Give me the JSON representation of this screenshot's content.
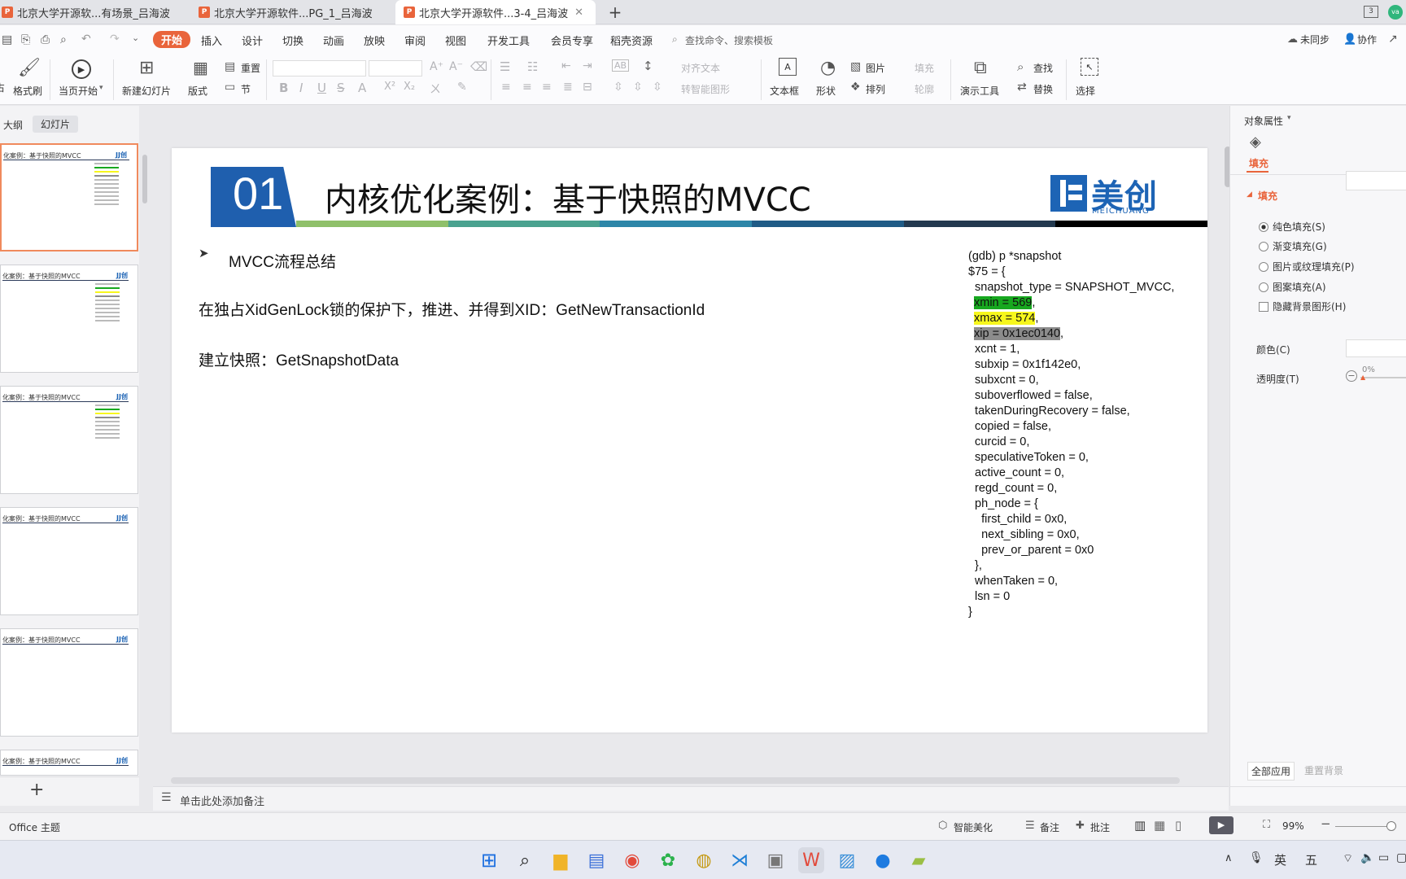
{
  "tabs": [
    {
      "label": "北京大学开源软...有场景_吕海波",
      "active": false
    },
    {
      "label": "北京大学开源软件...PG_1_吕海波",
      "active": false
    },
    {
      "label": "北京大学开源软件...3-4_吕海波",
      "active": true
    }
  ],
  "tabbar": {
    "new_tab": "+",
    "win_badge": "3"
  },
  "menu": {
    "items": [
      "开始",
      "插入",
      "设计",
      "切换",
      "动画",
      "放映",
      "审阅",
      "视图",
      "开发工具",
      "会员专享",
      "稻壳资源"
    ],
    "search_placeholder": "查找命令、搜索模板",
    "sync": "未同步",
    "collab": "协作"
  },
  "ribbon": {
    "format_painter": "格式刷",
    "play_from_current": "当页开始",
    "new_slide": "新建幻灯片",
    "layout": "版式",
    "reset": "重置",
    "section": "节",
    "align_text": "对齐文本",
    "smart_graphic": "转智能图形",
    "textbox": "文本框",
    "shape": "形状",
    "picture": "图片",
    "arrange": "排列",
    "fill": "填充",
    "outline": "轮廓",
    "present_tools": "演示工具",
    "find": "查找",
    "replace": "替换",
    "select": "选择"
  },
  "panel": {
    "outline_tab": "大纲",
    "slides_tab": "幻灯片",
    "thumb_title": "化案例：基于快照的MVCC",
    "thumb_logo": "JJ创",
    "add": "+"
  },
  "slide": {
    "number": "01",
    "title": "内核优化案例：基于快照的MVCC",
    "logo_main": "美创",
    "logo_sub": "MEICHUANG",
    "bullet": "MVCC流程总结",
    "para1": "在独占XidGenLock锁的保护下，推进、并得到XID：GetNewTransactionId",
    "para2": "建立快照：GetSnapshotData",
    "code": {
      "l1": "(gdb) p *snapshot",
      "l2": "$75 = {",
      "l3": "  snapshot_type = SNAPSHOT_MVCC,",
      "l4a": "xmin = 569",
      "l5a": "xmax = 574",
      "l6a": "xip = 0x1ec0140",
      "comma": ",",
      "l7": "  xcnt = 1,",
      "l8": "  subxip = 0x1f142e0,",
      "l9": "  subxcnt = 0,",
      "l10": "  suboverflowed = false,",
      "l11": "  takenDuringRecovery = false,",
      "l12": "  copied = false,",
      "l13": "  curcid = 0,",
      "l14": "  speculativeToken = 0,",
      "l15": "  active_count = 0,",
      "l16": "  regd_count = 0,",
      "l17": "  ph_node = {",
      "l18": "    first_child = 0x0,",
      "l19": "    next_sibling = 0x0,",
      "l20": "    prev_or_parent = 0x0",
      "l21": "  },",
      "l22": "  whenTaken = 0,",
      "l23": "  lsn = 0",
      "l24": "}"
    }
  },
  "rightpanel": {
    "header": "对象属性",
    "fill_tab": "填充",
    "fill_section": "填充",
    "options": [
      "纯色填充(S)",
      "渐变填充(G)",
      "图片或纹理填充(P)",
      "图案填充(A)"
    ],
    "hide_bg": "隐藏背景图形(H)",
    "color": "颜色(C)",
    "transparency": "透明度(T)",
    "transparency_value": "0%",
    "apply_all": "全部应用",
    "reset_bg": "重置背景"
  },
  "notes": {
    "placeholder": "单击此处添加备注"
  },
  "status": {
    "theme": "Office 主题",
    "beautify": "智能美化",
    "notes": "备注",
    "comment": "批注",
    "zoom": "99%"
  },
  "tray": {
    "ime1": "英",
    "ime2": "五"
  },
  "colors": {
    "accent": "#e9643b",
    "title_blue": "#1f5fae",
    "code_green": "#17a81f",
    "code_yellow": "#f7f71d",
    "code_gray": "#8c8c8c"
  }
}
